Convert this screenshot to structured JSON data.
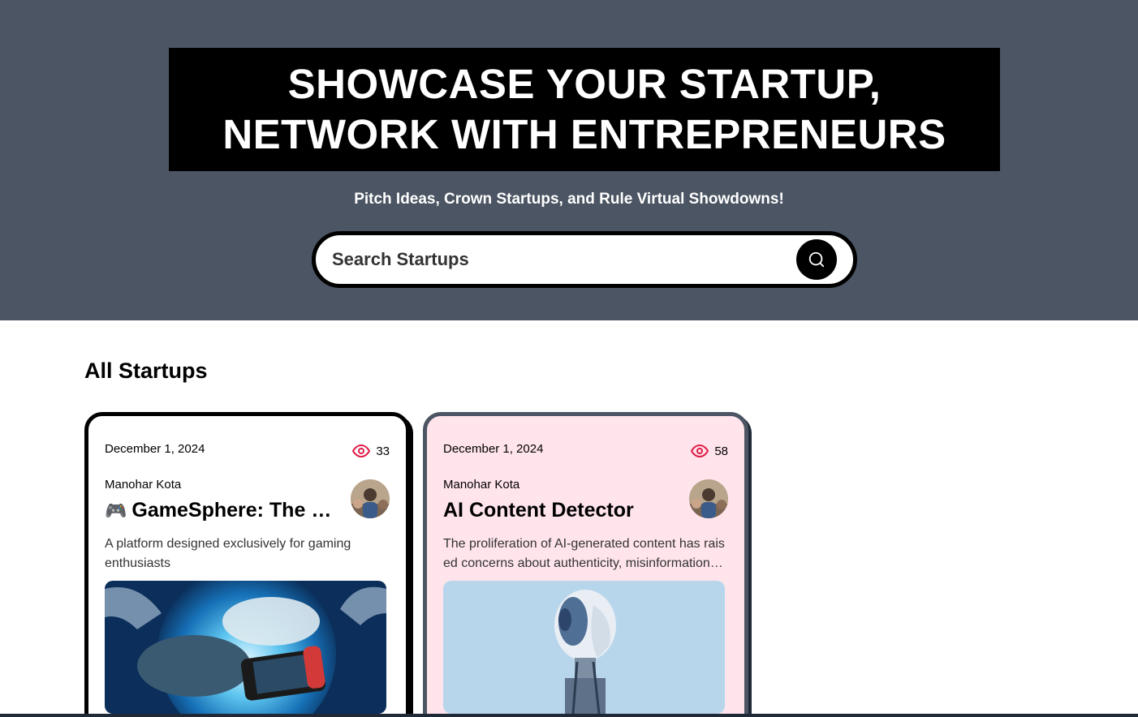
{
  "hero": {
    "headline_line1": "SHOWCASE YOUR STARTUP,",
    "headline_line2": "NETWORK WITH ENTREPRENEURS",
    "tagline": "Pitch Ideas, Crown Startups, and Rule Virtual Showdowns!",
    "search_placeholder": "Search Startups",
    "search_icon": "search-icon",
    "background_color": "#4b5563"
  },
  "section": {
    "title": "All Startups"
  },
  "startups": [
    {
      "date": "December 1, 2024",
      "views": "33",
      "author": "Manohar Kota",
      "emoji": "🎮",
      "title": "GameSphere: The Ultimate Gaming Hub",
      "description": "A platform designed exclusively for gaming enthusiasts",
      "image_alt": "Game controllers and handheld console in blue energy sphere"
    },
    {
      "date": "December 1, 2024",
      "views": "58",
      "author": "Manohar Kota",
      "emoji": "",
      "title": "AI Content Detector",
      "description": "The proliferation of AI-generated content has raised concerns about authenticity, misinformation, and originality",
      "image_alt": "Humanoid robot head on light blue background"
    }
  ],
  "colors": {
    "accent": "#e11d48",
    "highlight_card": "#ffe4ec"
  }
}
